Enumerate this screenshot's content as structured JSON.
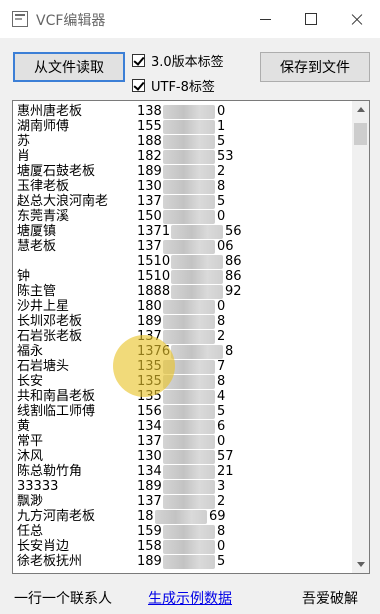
{
  "window": {
    "title": "VCF编辑器",
    "icon": "notepad-icon"
  },
  "toolbar": {
    "read_file_label": "从文件读取",
    "save_file_label": "保存到文件",
    "version_checkbox": {
      "label": "3.0版本标签",
      "checked": true
    },
    "utf8_checkbox": {
      "label": "UTF-8标签",
      "checked": true
    }
  },
  "contacts": [
    {
      "name": "惠州唐老板",
      "phone_start": "138",
      "phone_end": "0"
    },
    {
      "name": "湖南师傅",
      "phone_start": "155",
      "phone_end": "1"
    },
    {
      "name": "苏",
      "phone_start": "188",
      "phone_end": "5"
    },
    {
      "name": "肖",
      "phone_start": "182",
      "phone_end": "53"
    },
    {
      "name": "塘厦石鼓老板",
      "phone_start": "189",
      "phone_end": "2"
    },
    {
      "name": "玉律老板",
      "phone_start": "130",
      "phone_end": "8"
    },
    {
      "name": "赵总大浪河南老",
      "phone_start": "137",
      "phone_end": "5"
    },
    {
      "name": "东莞青溪",
      "phone_start": "150",
      "phone_end": "0"
    },
    {
      "name": "塘厦镇",
      "phone_start": "1371",
      "phone_end": "56"
    },
    {
      "name": "慧老板",
      "phone_start": "137",
      "phone_end": "06"
    },
    {
      "name": "",
      "phone_start": "1510",
      "phone_end": "86"
    },
    {
      "name": "钟",
      "phone_start": "1510",
      "phone_end": "86"
    },
    {
      "name": "陈主管",
      "phone_start": "1888",
      "phone_end": "92"
    },
    {
      "name": "沙井上星",
      "phone_start": "180",
      "phone_end": "0"
    },
    {
      "name": "长圳邓老板",
      "phone_start": "189",
      "phone_end": "8"
    },
    {
      "name": "石岩张老板",
      "phone_start": "137",
      "phone_end": "2"
    },
    {
      "name": "福永",
      "phone_start": "1376",
      "phone_end": "8"
    },
    {
      "name": "石岩塘头",
      "phone_start": "135",
      "phone_end": "7"
    },
    {
      "name": "长安",
      "phone_start": "135",
      "phone_end": "8"
    },
    {
      "name": "共和南昌老板",
      "phone_start": "135",
      "phone_end": "4"
    },
    {
      "name": "线割临工师傅",
      "phone_start": "156",
      "phone_end": "5"
    },
    {
      "name": "黄",
      "phone_start": "134",
      "phone_end": "6"
    },
    {
      "name": "常平",
      "phone_start": "137",
      "phone_end": "0"
    },
    {
      "name": "沐风",
      "phone_start": "130",
      "phone_end": "57"
    },
    {
      "name": "陈总勒竹角",
      "phone_start": "134",
      "phone_end": "21"
    },
    {
      "name": "33333",
      "phone_start": "189",
      "phone_end": "3"
    },
    {
      "name": "飘渺",
      "phone_start": "137",
      "phone_end": "2"
    },
    {
      "name": "九方河南老板",
      "phone_start": "18",
      "phone_end": "69"
    },
    {
      "name": "任总",
      "phone_start": "159",
      "phone_end": "8"
    },
    {
      "name": "长安肖边",
      "phone_start": "158",
      "phone_end": "0"
    },
    {
      "name": "徐老板抚州",
      "phone_start": "189",
      "phone_end": "5"
    }
  ],
  "statusbar": {
    "hint": "一行一个联系人",
    "generate_link": "生成示例数据",
    "credit": "吾爱破解"
  }
}
